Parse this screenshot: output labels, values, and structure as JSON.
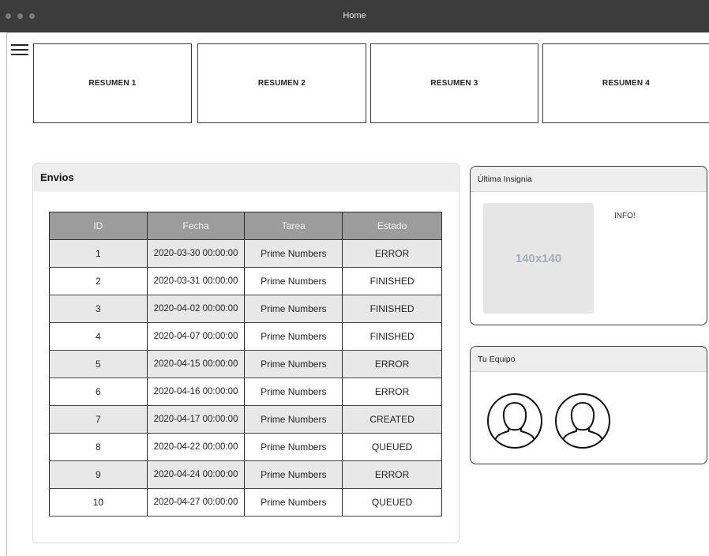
{
  "window": {
    "title": "Home"
  },
  "summary_cards": [
    {
      "label": "RESUMEN 1"
    },
    {
      "label": "RESUMEN 2"
    },
    {
      "label": "RESUMEN 3"
    },
    {
      "label": "RESUMEN 4"
    }
  ],
  "envios": {
    "title": "Envios",
    "columns": [
      "ID",
      "Fecha",
      "Tarea",
      "Estado"
    ],
    "rows": [
      {
        "id": "1",
        "fecha": "2020-03-30 00:00:00",
        "tarea": "Prime Numbers",
        "estado": "ERROR"
      },
      {
        "id": "2",
        "fecha": "2020-03-31 00:00:00",
        "tarea": "Prime Numbers",
        "estado": "FINISHED"
      },
      {
        "id": "3",
        "fecha": "2020-04-02 00:00:00",
        "tarea": "Prime Numbers",
        "estado": "FINISHED"
      },
      {
        "id": "4",
        "fecha": "2020-04-07 00:00:00",
        "tarea": "Prime Numbers",
        "estado": "FINISHED"
      },
      {
        "id": "5",
        "fecha": "2020-04-15 00:00:00",
        "tarea": "Prime Numbers",
        "estado": "ERROR"
      },
      {
        "id": "6",
        "fecha": "2020-04-16 00:00:00",
        "tarea": "Prime Numbers",
        "estado": "ERROR"
      },
      {
        "id": "7",
        "fecha": "2020-04-17 00:00:00",
        "tarea": "Prime Numbers",
        "estado": "CREATED"
      },
      {
        "id": "8",
        "fecha": "2020-04-22 00:00:00",
        "tarea": "Prime Numbers",
        "estado": "QUEUED"
      },
      {
        "id": "9",
        "fecha": "2020-04-24 00:00:00",
        "tarea": "Prime Numbers",
        "estado": "ERROR"
      },
      {
        "id": "10",
        "fecha": "2020-04-27 00:00:00",
        "tarea": "Prime Numbers",
        "estado": "QUEUED"
      }
    ]
  },
  "badge_panel": {
    "title": "Última Insignia",
    "image_placeholder": "140x140",
    "info": "INFO!"
  },
  "team_panel": {
    "title": "Tu Equipo",
    "members": [
      {
        "icon": "user-avatar-icon"
      },
      {
        "icon": "user-avatar-icon"
      }
    ]
  },
  "icons": {
    "menu": "hamburger-menu-icon"
  }
}
